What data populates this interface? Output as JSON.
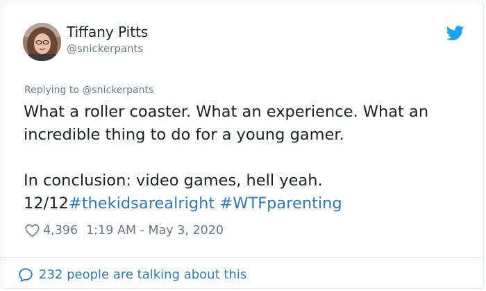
{
  "author": {
    "name": "Tiffany Pitts",
    "handle": "@snickerpants"
  },
  "reply": {
    "prefix": "Replying to ",
    "mention": "@snickerpants"
  },
  "tweet": {
    "line1": "What a roller coaster. What an experience. What an",
    "line2": "incredible thing to do for a young gamer.",
    "line3": "In conclusion: video games, hell yeah.",
    "line4_prefix": "12/12",
    "hashtag1": "#thekidsarealright",
    "hashtag2": "#WTFparenting"
  },
  "meta": {
    "likes": "4,396",
    "timestamp": "1:19 AM - May 3, 2020"
  },
  "footer": {
    "talking": "232 people are talking about this"
  },
  "icons": {
    "brand": "twitter-bird-icon",
    "like": "heart-icon",
    "comment": "speech-bubble-icon"
  },
  "colors": {
    "brand_blue": "#1da1f2",
    "link_blue": "#2b7bb9",
    "muted": "#697882",
    "text": "#1c2022"
  }
}
